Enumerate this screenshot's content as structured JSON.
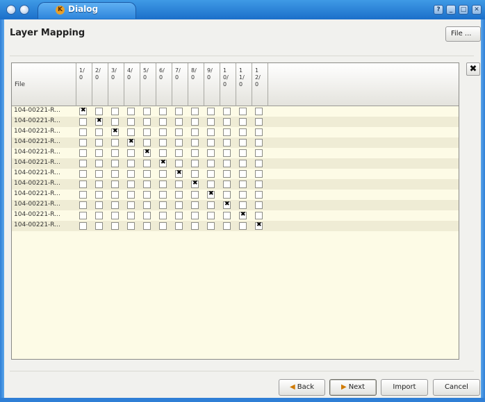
{
  "window": {
    "title": "Dialog",
    "app_icon_letter": "K",
    "controls": [
      "?",
      "_",
      "□",
      "✕"
    ]
  },
  "heading": "Layer Mapping",
  "file_menu": "File ...",
  "table": {
    "file_header": "File",
    "columns": [
      "1/0",
      "2/0",
      "3/0",
      "4/0",
      "5/0",
      "6/0",
      "7/0",
      "8/0",
      "9/0",
      "10/0",
      "11/0",
      "12/0"
    ],
    "rows": [
      {
        "file": "104-00221-R...",
        "checked": [
          1,
          0,
          0,
          0,
          0,
          0,
          0,
          0,
          0,
          0,
          0,
          0
        ]
      },
      {
        "file": "104-00221-R...",
        "checked": [
          0,
          1,
          0,
          0,
          0,
          0,
          0,
          0,
          0,
          0,
          0,
          0
        ]
      },
      {
        "file": "104-00221-R...",
        "checked": [
          0,
          0,
          1,
          0,
          0,
          0,
          0,
          0,
          0,
          0,
          0,
          0
        ]
      },
      {
        "file": "104-00221-R...",
        "checked": [
          0,
          0,
          0,
          1,
          0,
          0,
          0,
          0,
          0,
          0,
          0,
          0
        ]
      },
      {
        "file": "104-00221-R...",
        "checked": [
          0,
          0,
          0,
          0,
          1,
          0,
          0,
          0,
          0,
          0,
          0,
          0
        ]
      },
      {
        "file": "104-00221-R...",
        "checked": [
          0,
          0,
          0,
          0,
          0,
          1,
          0,
          0,
          0,
          0,
          0,
          0
        ]
      },
      {
        "file": "104-00221-R...",
        "checked": [
          0,
          0,
          0,
          0,
          0,
          0,
          1,
          0,
          0,
          0,
          0,
          0
        ]
      },
      {
        "file": "104-00221-R...",
        "checked": [
          0,
          0,
          0,
          0,
          0,
          0,
          0,
          1,
          0,
          0,
          0,
          0
        ]
      },
      {
        "file": "104-00221-R...",
        "checked": [
          0,
          0,
          0,
          0,
          0,
          0,
          0,
          0,
          1,
          0,
          0,
          0
        ]
      },
      {
        "file": "104-00221-R...",
        "checked": [
          0,
          0,
          0,
          0,
          0,
          0,
          0,
          0,
          0,
          1,
          0,
          0
        ]
      },
      {
        "file": "104-00221-R...",
        "checked": [
          0,
          0,
          0,
          0,
          0,
          0,
          0,
          0,
          0,
          0,
          1,
          0
        ]
      },
      {
        "file": "104-00221-R...",
        "checked": [
          0,
          0,
          0,
          0,
          0,
          0,
          0,
          0,
          0,
          0,
          0,
          1
        ]
      }
    ]
  },
  "remove_button": "✖",
  "buttons": {
    "back": "Back",
    "next": "Next",
    "import": "Import",
    "cancel": "Cancel"
  }
}
